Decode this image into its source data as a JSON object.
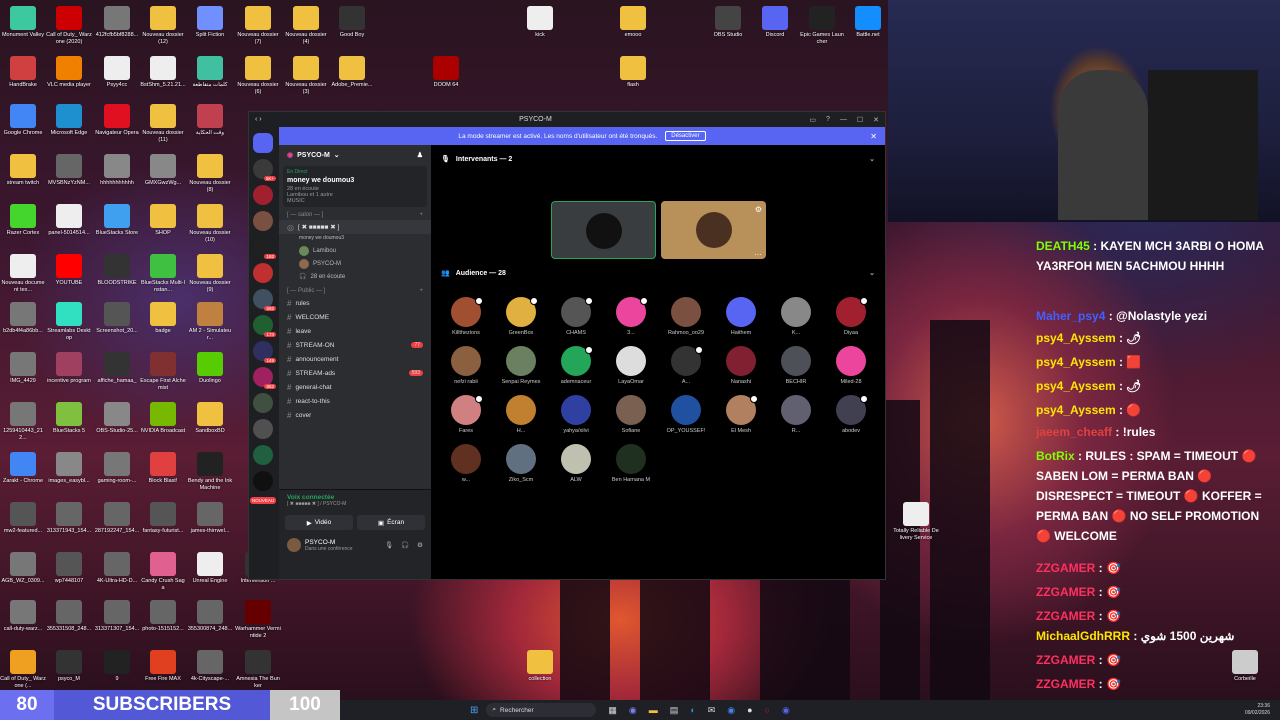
{
  "desktop_icons": [
    {
      "label": "Monument Valley",
      "color": "#3cc9a0"
    },
    {
      "label": "Call of Duty_ Warzone (2020)",
      "color": "#c00"
    },
    {
      "label": "412fcfb5bf8288...",
      "color": "#777"
    },
    {
      "label": "Nouveau dossier (12)",
      "color": "#f0c040"
    },
    {
      "label": "Split Fiction",
      "color": "#7090ff"
    },
    {
      "label": "Nouveau dossier (7)",
      "color": "#f0c040"
    },
    {
      "label": "Nouveau dossier (4)",
      "color": "#f0c040"
    },
    {
      "label": "Good Boy",
      "color": "#333"
    },
    {
      "label": "HandBrake",
      "color": "#d04040"
    },
    {
      "label": "VLC media player",
      "color": "#f08000"
    },
    {
      "label": "Psyy4cc",
      "color": "#eee"
    },
    {
      "label": "BstShm_5.21.21...",
      "color": "#eee"
    },
    {
      "label": "كلمات متقاطعة",
      "color": "#40c0a0"
    },
    {
      "label": "Nouveau dossier (6)",
      "color": "#f0c040"
    },
    {
      "label": "Nouveau dossier (3)",
      "color": "#f0c040"
    },
    {
      "label": "Adobe_Premie...",
      "color": "#f0c040"
    },
    {
      "label": "Google Chrome",
      "color": "#4285f4"
    },
    {
      "label": "Microsoft Edge",
      "color": "#1e90d0"
    },
    {
      "label": "Navigateur Opera",
      "color": "#e01020"
    },
    {
      "label": "Nouveau dossier (11)",
      "color": "#f0c040"
    },
    {
      "label": "وقت الحكاية",
      "color": "#c04050"
    },
    {
      "label": "stream twitch",
      "color": "#f0c040"
    },
    {
      "label": "MVSBNzYzNM...",
      "color": "#666"
    },
    {
      "label": "hhhhhhhhhhh",
      "color": "#888"
    },
    {
      "label": "GMXGwzWg...",
      "color": "#888"
    },
    {
      "label": "Nouveau dossier (8)",
      "color": "#f0c040"
    },
    {
      "label": "Razer Cortex",
      "color": "#44d62c"
    },
    {
      "label": "panel-5014514...",
      "color": "#eee"
    },
    {
      "label": "BlueStacks Store",
      "color": "#40a0f0"
    },
    {
      "label": "SHOP",
      "color": "#f0c040"
    },
    {
      "label": "Nouveau dossier (10)",
      "color": "#f0c040"
    },
    {
      "label": "Nouveau document tex...",
      "color": "#eee"
    },
    {
      "label": "YOUTUBE",
      "color": "#f00"
    },
    {
      "label": "BLOODSTRIKE",
      "color": "#333"
    },
    {
      "label": "BlueStacks Multi-Instan...",
      "color": "#40c040"
    },
    {
      "label": "Nouveau dossier (9)",
      "color": "#f0c040"
    },
    {
      "label": "b2db4f4a86bb...",
      "color": "#777"
    },
    {
      "label": "Streamlabs Desktop",
      "color": "#30e0c0"
    },
    {
      "label": "Screenshot_20...",
      "color": "#555"
    },
    {
      "label": "badge",
      "color": "#f0c040"
    },
    {
      "label": "AM 2 - Simulateur...",
      "color": "#c08040"
    },
    {
      "label": "IMG_4429",
      "color": "#777"
    },
    {
      "label": "incentive program",
      "color": "#a04060"
    },
    {
      "label": "affiche_hamaa_",
      "color": "#333"
    },
    {
      "label": "Escape First Alchemist",
      "color": "#803030"
    },
    {
      "label": "Duolingo",
      "color": "#58cc02"
    },
    {
      "label": "1259410443_212...",
      "color": "#777"
    },
    {
      "label": "BlueStacks 5",
      "color": "#80c040"
    },
    {
      "label": "OBS-Studio-25...",
      "color": "#888"
    },
    {
      "label": "NVIDIA Broadcast",
      "color": "#76b900"
    },
    {
      "label": "SandboxBD",
      "color": "#f0c040"
    },
    {
      "label": "Zarakt - Chrome",
      "color": "#4285f4"
    },
    {
      "label": "images_easybl...",
      "color": "#888"
    },
    {
      "label": "gaming-room-...",
      "color": "#777"
    },
    {
      "label": "Block Blast!",
      "color": "#e04040"
    },
    {
      "label": "Bendy and the Ink Machine",
      "color": "#222"
    },
    {
      "label": "mw2-featured...",
      "color": "#555"
    },
    {
      "label": "313371943_154...",
      "color": "#666"
    },
    {
      "label": "287192247_154...",
      "color": "#666"
    },
    {
      "label": "fantasy-futurist...",
      "color": "#555"
    },
    {
      "label": "james-thirrwel...",
      "color": "#666"
    },
    {
      "label": "AGB_WZ_0309...",
      "color": "#777"
    },
    {
      "label": "wp7448107",
      "color": "#555"
    },
    {
      "label": "4K-Ultra-HD-D...",
      "color": "#666"
    },
    {
      "label": "Candy Crush Saga",
      "color": "#e06090"
    },
    {
      "label": "Unreal Engine",
      "color": "#eee"
    },
    {
      "label": "call-duty-warz...",
      "color": "#777"
    },
    {
      "label": "355331508_248...",
      "color": "#666"
    },
    {
      "label": "313371307_154...",
      "color": "#666"
    },
    {
      "label": "photo-1515152...",
      "color": "#666"
    },
    {
      "label": "355300874_248...",
      "color": "#666"
    },
    {
      "label": "Call of Duty_ Warzone (...",
      "color": "#f0a020"
    },
    {
      "label": "psyco_M",
      "color": "#333"
    },
    {
      "label": "9",
      "color": "#222"
    },
    {
      "label": "Free Fire MAX",
      "color": "#e04020"
    },
    {
      "label": "4k-Cityscape-...",
      "color": "#666"
    },
    {
      "label": "kick",
      "color": "#eee"
    },
    {
      "label": "emooo",
      "color": "#f0c040"
    },
    {
      "label": "flash",
      "color": "#f0c040"
    },
    {
      "label": "DOOM 64",
      "color": "#a00"
    },
    {
      "label": "OBS Studio",
      "color": "#444"
    },
    {
      "label": "Discord",
      "color": "#5865f2"
    },
    {
      "label": "Epic Games Launcher",
      "color": "#222"
    },
    {
      "label": "Battle.net",
      "color": "#148eff"
    },
    {
      "label": "Intervention ...",
      "color": "#333"
    },
    {
      "label": "Warhammer Vermintide 2",
      "color": "#600"
    },
    {
      "label": "Amnesia The Bunker",
      "color": "#333"
    },
    {
      "label": "Totally Reliable Delivery Service",
      "color": "#eee"
    },
    {
      "label": "collection",
      "color": "#f0c040"
    },
    {
      "label": "Corbeille",
      "color": "#ccc"
    }
  ],
  "discord": {
    "window_title": "PSYCO-M",
    "banner_text": "La mode streamer est activé. Les noms d'utilisateur ont été tronqués.",
    "banner_button": "Désactiver",
    "server_name": "PSYCO-M",
    "live": {
      "status": "En Direct",
      "title": "money we doumou3",
      "listeners": "28 en écoute",
      "users": "Lamibou et 1 autre",
      "extra": "MUSIC"
    },
    "categories": {
      "salon": "[ — salon — ]",
      "public": "[ — Public — ]"
    },
    "voice_channel": {
      "name": "[ ✖ ■■■■■ ✖ ]",
      "sub": "money we doumou3",
      "users": [
        "Lamibou",
        "PSYCO-M",
        "28 en écoute"
      ]
    },
    "text_channels": [
      {
        "name": "rules",
        "badge": ""
      },
      {
        "name": "WELCOME",
        "badge": ""
      },
      {
        "name": "leave",
        "badge": ""
      },
      {
        "name": "STREAM-ON",
        "badge": "77"
      },
      {
        "name": "announcement",
        "badge": ""
      },
      {
        "name": "STREAM-ads",
        "badge": "593"
      },
      {
        "name": "general-chat",
        "badge": ""
      },
      {
        "name": "react-to-this",
        "badge": ""
      },
      {
        "name": "cover",
        "badge": ""
      }
    ],
    "voice_panel": {
      "status": "Voix connectée",
      "sub": "[ ✖ ■■■■■ ✖ ] / PSYCO-M",
      "video": "Vidéo",
      "screen": "Écran",
      "user": "PSYCO-M",
      "user_status": "Dans une conférence"
    },
    "guild_badges": [
      "5K+",
      "192",
      "692",
      "174",
      "149",
      "862",
      "NOUVEAU"
    ],
    "speakers_label": "Intervenants — 2",
    "audience_label": "Audience — 28",
    "audience": [
      {
        "name": "Killthezions",
        "color": "#a05030"
      },
      {
        "name": "GreenBox",
        "color": "#e0b040"
      },
      {
        "name": "CHAMS",
        "color": "#555"
      },
      {
        "name": "3...",
        "color": "#eb459e"
      },
      {
        "name": "Rahmoo_oo29",
        "color": "#7a5040"
      },
      {
        "name": "Haithem",
        "color": "#5865f2"
      },
      {
        "name": "K...",
        "color": "#888"
      },
      {
        "name": "Diyaa",
        "color": "#a02030"
      },
      {
        "name": "nefzi rabii",
        "color": "#8a6040"
      },
      {
        "name": "Senpai Reymes",
        "color": "#6a8060"
      },
      {
        "name": "ademnaceur",
        "color": "#23a55a"
      },
      {
        "name": "LayaOmar",
        "color": "#ddd"
      },
      {
        "name": "A...",
        "color": "#333"
      },
      {
        "name": "Nanashi",
        "color": "#802030"
      },
      {
        "name": "BECHIR",
        "color": "#4e5058"
      },
      {
        "name": "Miled-28",
        "color": "#eb459e"
      },
      {
        "name": "Fares",
        "color": "#d08080"
      },
      {
        "name": "H...",
        "color": "#c08030"
      },
      {
        "name": "yahya/xilvi",
        "color": "#3040a0"
      },
      {
        "name": "Sofiane",
        "color": "#7a6050"
      },
      {
        "name": "OP_YOUSSEF!",
        "color": "#2050a0"
      },
      {
        "name": "El Mesh",
        "color": "#b08060"
      },
      {
        "name": "R...",
        "color": "#606070"
      },
      {
        "name": "abodev",
        "color": "#404050"
      },
      {
        "name": "w...",
        "color": "#603020"
      },
      {
        "name": "Ziko_Scm",
        "color": "#607080"
      },
      {
        "name": "ALW",
        "color": "#c0c0b0"
      },
      {
        "name": "Ben Hamana M",
        "color": "#203020"
      }
    ]
  },
  "chat": [
    {
      "user": "DEATH45",
      "text": "KAYEN MCH 3ARBI O HOMA YA3RFOH MEN 5ACHMOU HHHH",
      "userColor": "#7fff00"
    },
    {
      "user": "Maher_psy4",
      "text": "@Nolastyle yezi",
      "userColor": "#4060ff"
    },
    {
      "user": "psy4_Ayssem",
      "text": "🌶",
      "userColor": "#ffe600"
    },
    {
      "user": "psy4_Ayssem",
      "text": "🟥",
      "userColor": "#ffe600"
    },
    {
      "user": "psy4_Ayssem",
      "text": "🌶",
      "userColor": "#ffe600"
    },
    {
      "user": "psy4_Ayssem",
      "text": "🔴",
      "userColor": "#ffe600"
    },
    {
      "user": "jaeem_cheaff",
      "text": "!rules",
      "userColor": "#e04040"
    },
    {
      "user": "BotRix",
      "text": "RULES : SPAM = TIMEOUT 🔴 SABEN LOM = PERMA BAN 🔴 DISRESPECT = TIMEOUT 🔴 KOFFER = PERMA BAN 🔴 NO SELF PROMOTION 🔴 WELCOME",
      "userColor": "#7fff00"
    },
    {
      "user": "ZZGAMER",
      "text": "🎯",
      "userColor": "#ff3060"
    },
    {
      "user": "ZZGAMER",
      "text": "🎯",
      "userColor": "#ff3060"
    },
    {
      "user": "ZZGAMER",
      "text": "🎯",
      "userColor": "#ff3060"
    },
    {
      "user": "MichaalGdhRRR",
      "text": "شهرين 1500 شوي",
      "userColor": "#ffe600"
    },
    {
      "user": "ZZGAMER",
      "text": "🎯",
      "userColor": "#ff3060"
    },
    {
      "user": "ZZGAMER",
      "text": "🎯",
      "userColor": "#ff3060"
    }
  ],
  "subs": {
    "current": "80",
    "label": "SUBSCRIBERS",
    "goal": "100",
    "progress": 0.8
  },
  "taskbar": {
    "search": "Rechercher",
    "time": "23:36",
    "date": "09/02/2026"
  }
}
